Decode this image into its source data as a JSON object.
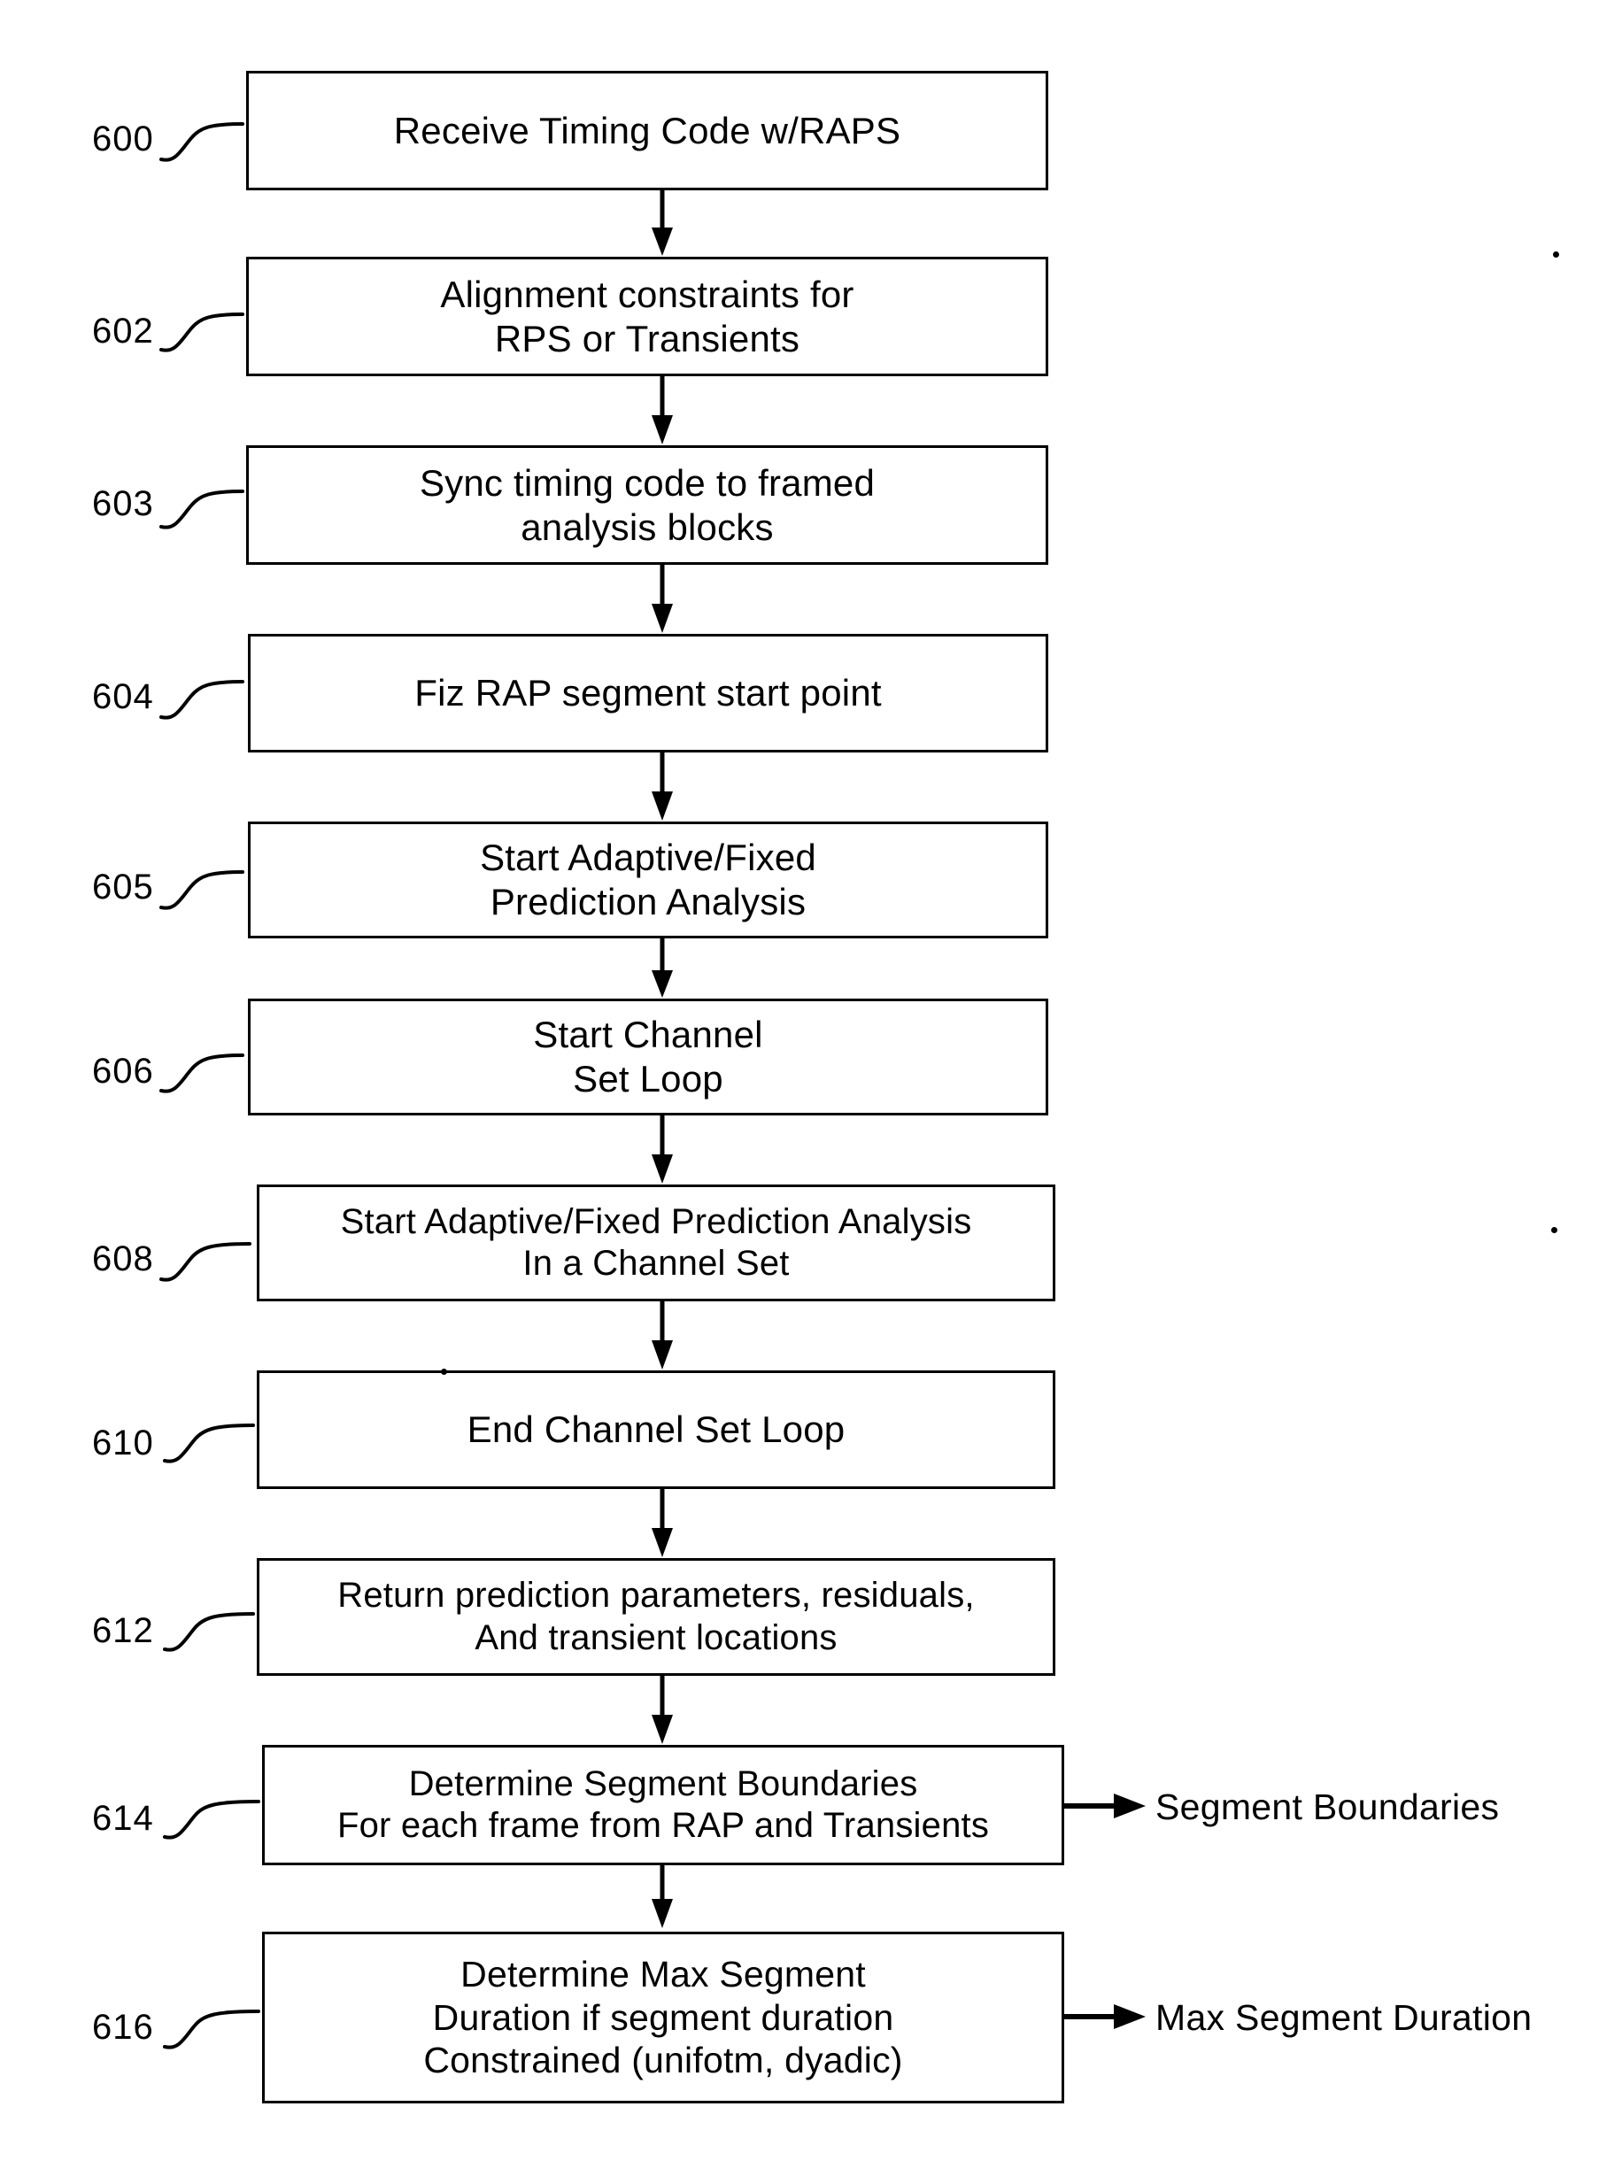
{
  "figure": {
    "type": "flowchart",
    "orientation": "vertical",
    "background_color": "#ffffff",
    "line_color": "#000000"
  },
  "nodes": [
    {
      "ref": "600",
      "label": "Receive Timing Code w/RAPS",
      "lines": 1,
      "font_size": 42
    },
    {
      "ref": "602",
      "label": "Alignment constraints for\nRPS or Transients",
      "lines": 2,
      "font_size": 42
    },
    {
      "ref": "603",
      "label": "Sync timing code to framed\nanalysis blocks",
      "lines": 2,
      "font_size": 42
    },
    {
      "ref": "604",
      "label": "Fiz RAP segment start point",
      "lines": 1,
      "font_size": 42
    },
    {
      "ref": "605",
      "label": "Start Adaptive/Fixed\nPrediction Analysis",
      "lines": 2,
      "font_size": 42
    },
    {
      "ref": "606",
      "label": "Start Channel\nSet Loop",
      "lines": 2,
      "font_size": 42
    },
    {
      "ref": "608",
      "label": "Start Adaptive/Fixed Prediction Analysis\nIn a Channel Set",
      "lines": 2,
      "font_size": 40
    },
    {
      "ref": "610",
      "label": "End Channel Set Loop",
      "lines": 1,
      "font_size": 42
    },
    {
      "ref": "612",
      "label": "Return prediction parameters, residuals,\nAnd transient locations",
      "lines": 2,
      "font_size": 40
    },
    {
      "ref": "614",
      "label": "Determine Segment Boundaries\nFor each frame from RAP and Transients",
      "lines": 2,
      "font_size": 40
    },
    {
      "ref": "616",
      "label": "Determine Max Segment\nDuration if segment duration\nConstrained (unifotm, dyadic)",
      "lines": 3,
      "font_size": 41
    }
  ],
  "outputs": [
    {
      "from_ref": "614",
      "label": "Segment Boundaries"
    },
    {
      "from_ref": "616",
      "label": "Max Segment Duration"
    }
  ]
}
